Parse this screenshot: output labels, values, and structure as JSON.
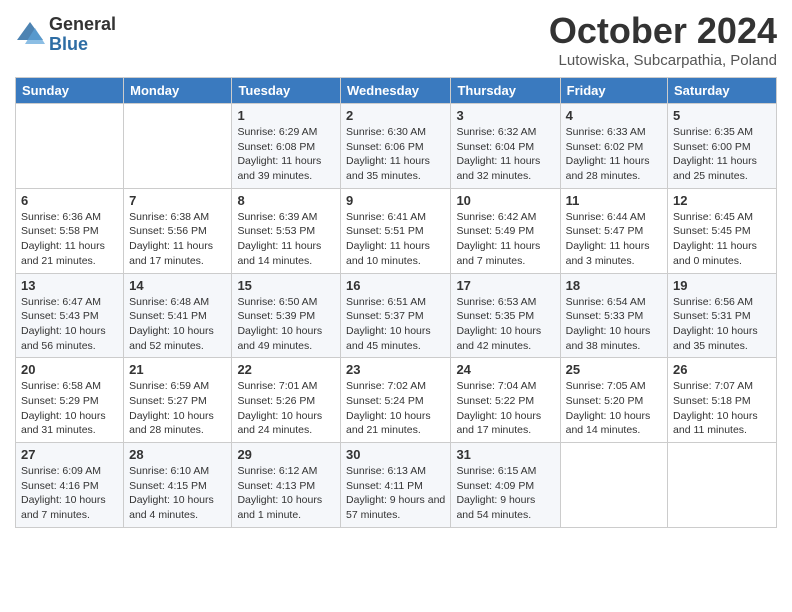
{
  "header": {
    "logo_general": "General",
    "logo_blue": "Blue",
    "title": "October 2024",
    "subtitle": "Lutowiska, Subcarpathia, Poland"
  },
  "weekdays": [
    "Sunday",
    "Monday",
    "Tuesday",
    "Wednesday",
    "Thursday",
    "Friday",
    "Saturday"
  ],
  "rows": [
    [
      {
        "day": "",
        "info": ""
      },
      {
        "day": "",
        "info": ""
      },
      {
        "day": "1",
        "info": "Sunrise: 6:29 AM\nSunset: 6:08 PM\nDaylight: 11 hours and 39 minutes."
      },
      {
        "day": "2",
        "info": "Sunrise: 6:30 AM\nSunset: 6:06 PM\nDaylight: 11 hours and 35 minutes."
      },
      {
        "day": "3",
        "info": "Sunrise: 6:32 AM\nSunset: 6:04 PM\nDaylight: 11 hours and 32 minutes."
      },
      {
        "day": "4",
        "info": "Sunrise: 6:33 AM\nSunset: 6:02 PM\nDaylight: 11 hours and 28 minutes."
      },
      {
        "day": "5",
        "info": "Sunrise: 6:35 AM\nSunset: 6:00 PM\nDaylight: 11 hours and 25 minutes."
      }
    ],
    [
      {
        "day": "6",
        "info": "Sunrise: 6:36 AM\nSunset: 5:58 PM\nDaylight: 11 hours and 21 minutes."
      },
      {
        "day": "7",
        "info": "Sunrise: 6:38 AM\nSunset: 5:56 PM\nDaylight: 11 hours and 17 minutes."
      },
      {
        "day": "8",
        "info": "Sunrise: 6:39 AM\nSunset: 5:53 PM\nDaylight: 11 hours and 14 minutes."
      },
      {
        "day": "9",
        "info": "Sunrise: 6:41 AM\nSunset: 5:51 PM\nDaylight: 11 hours and 10 minutes."
      },
      {
        "day": "10",
        "info": "Sunrise: 6:42 AM\nSunset: 5:49 PM\nDaylight: 11 hours and 7 minutes."
      },
      {
        "day": "11",
        "info": "Sunrise: 6:44 AM\nSunset: 5:47 PM\nDaylight: 11 hours and 3 minutes."
      },
      {
        "day": "12",
        "info": "Sunrise: 6:45 AM\nSunset: 5:45 PM\nDaylight: 11 hours and 0 minutes."
      }
    ],
    [
      {
        "day": "13",
        "info": "Sunrise: 6:47 AM\nSunset: 5:43 PM\nDaylight: 10 hours and 56 minutes."
      },
      {
        "day": "14",
        "info": "Sunrise: 6:48 AM\nSunset: 5:41 PM\nDaylight: 10 hours and 52 minutes."
      },
      {
        "day": "15",
        "info": "Sunrise: 6:50 AM\nSunset: 5:39 PM\nDaylight: 10 hours and 49 minutes."
      },
      {
        "day": "16",
        "info": "Sunrise: 6:51 AM\nSunset: 5:37 PM\nDaylight: 10 hours and 45 minutes."
      },
      {
        "day": "17",
        "info": "Sunrise: 6:53 AM\nSunset: 5:35 PM\nDaylight: 10 hours and 42 minutes."
      },
      {
        "day": "18",
        "info": "Sunrise: 6:54 AM\nSunset: 5:33 PM\nDaylight: 10 hours and 38 minutes."
      },
      {
        "day": "19",
        "info": "Sunrise: 6:56 AM\nSunset: 5:31 PM\nDaylight: 10 hours and 35 minutes."
      }
    ],
    [
      {
        "day": "20",
        "info": "Sunrise: 6:58 AM\nSunset: 5:29 PM\nDaylight: 10 hours and 31 minutes."
      },
      {
        "day": "21",
        "info": "Sunrise: 6:59 AM\nSunset: 5:27 PM\nDaylight: 10 hours and 28 minutes."
      },
      {
        "day": "22",
        "info": "Sunrise: 7:01 AM\nSunset: 5:26 PM\nDaylight: 10 hours and 24 minutes."
      },
      {
        "day": "23",
        "info": "Sunrise: 7:02 AM\nSunset: 5:24 PM\nDaylight: 10 hours and 21 minutes."
      },
      {
        "day": "24",
        "info": "Sunrise: 7:04 AM\nSunset: 5:22 PM\nDaylight: 10 hours and 17 minutes."
      },
      {
        "day": "25",
        "info": "Sunrise: 7:05 AM\nSunset: 5:20 PM\nDaylight: 10 hours and 14 minutes."
      },
      {
        "day": "26",
        "info": "Sunrise: 7:07 AM\nSunset: 5:18 PM\nDaylight: 10 hours and 11 minutes."
      }
    ],
    [
      {
        "day": "27",
        "info": "Sunrise: 6:09 AM\nSunset: 4:16 PM\nDaylight: 10 hours and 7 minutes."
      },
      {
        "day": "28",
        "info": "Sunrise: 6:10 AM\nSunset: 4:15 PM\nDaylight: 10 hours and 4 minutes."
      },
      {
        "day": "29",
        "info": "Sunrise: 6:12 AM\nSunset: 4:13 PM\nDaylight: 10 hours and 1 minute."
      },
      {
        "day": "30",
        "info": "Sunrise: 6:13 AM\nSunset: 4:11 PM\nDaylight: 9 hours and 57 minutes."
      },
      {
        "day": "31",
        "info": "Sunrise: 6:15 AM\nSunset: 4:09 PM\nDaylight: 9 hours and 54 minutes."
      },
      {
        "day": "",
        "info": ""
      },
      {
        "day": "",
        "info": ""
      }
    ]
  ]
}
